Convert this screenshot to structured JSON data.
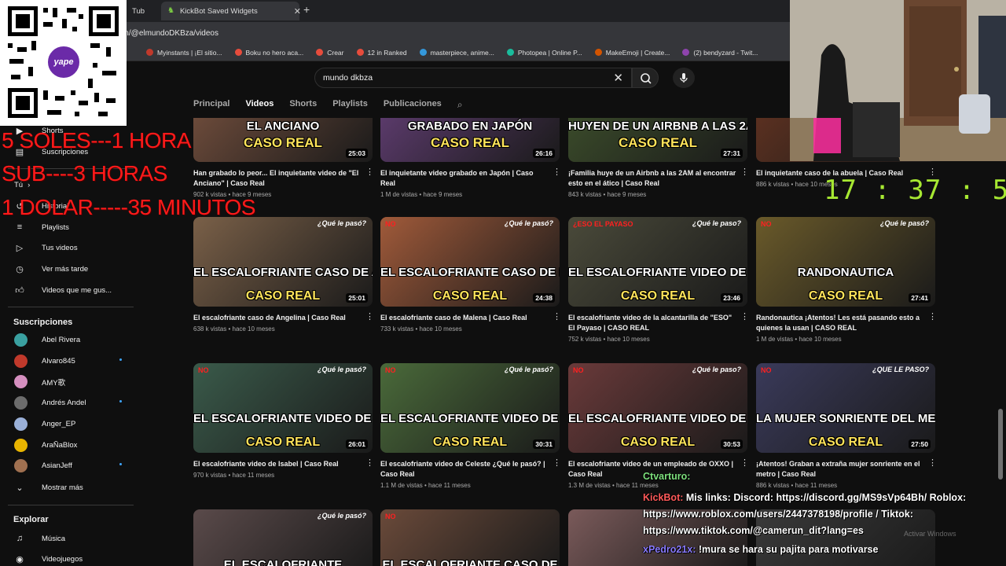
{
  "browser": {
    "tabs": [
      {
        "label": "Tub"
      },
      {
        "label": "KickBot Saved Widgets",
        "active": true
      }
    ],
    "new_tab_label": "+",
    "url": "om/@elmundoDKBza/videos",
    "bookmarks": [
      {
        "label": "Myinstants | ¡El sitio...",
        "color": "#c0392b"
      },
      {
        "label": "Boku no hero aca...",
        "color": "#e74c3c"
      },
      {
        "label": "Crear",
        "color": "#e74c3c"
      },
      {
        "label": "12 in Ranked",
        "color": "#e74c3c"
      },
      {
        "label": "masterpiece, anime...",
        "color": "#3498db"
      },
      {
        "label": "Photopea | Online P...",
        "color": "#1abc9c"
      },
      {
        "label": "MakeEmoji | Create...",
        "color": "#d35400"
      },
      {
        "label": "(2) bendyzard - Twit...",
        "color": "#8e44ad"
      }
    ]
  },
  "search": {
    "query": "mundo dkbza",
    "clear_icon": "close-icon",
    "search_icon": "search-icon",
    "mic_icon": "mic-icon"
  },
  "channel_tabs": [
    "Principal",
    "Videos",
    "Shorts",
    "Playlists",
    "Publicaciones"
  ],
  "sidebar": {
    "top_items": [
      {
        "label": "Shorts",
        "icon": "shorts-icon"
      },
      {
        "label": "Suscripciones",
        "icon": "subscriptions-icon"
      }
    ],
    "you_label": "Tú",
    "you_items": [
      {
        "label": "Historial",
        "icon": "history-icon"
      },
      {
        "label": "Playlists",
        "icon": "playlist-icon"
      },
      {
        "label": "Tus videos",
        "icon": "your-videos-icon"
      },
      {
        "label": "Ver más tarde",
        "icon": "clock-icon"
      },
      {
        "label": "Videos que me gus...",
        "icon": "thumbs-up-icon"
      }
    ],
    "subscriptions_heading": "Suscripciones",
    "subscriptions": [
      {
        "label": "Abel Rivera",
        "color": "#3aa0a0",
        "new": false
      },
      {
        "label": "Alvaro845",
        "color": "#c0392b",
        "new": true
      },
      {
        "label": "AMY歌",
        "color": "#d58fbf",
        "new": false
      },
      {
        "label": "Andrés Andel",
        "color": "#6c6c6c",
        "new": true
      },
      {
        "label": "Anger_EP",
        "color": "#9ab0d8",
        "new": false
      },
      {
        "label": "AraÑaBlox",
        "color": "#e8b400",
        "new": false
      },
      {
        "label": "AsianJeff",
        "color": "#a07050",
        "new": true
      }
    ],
    "show_more": "Mostrar más",
    "explore_heading": "Explorar",
    "explore_items": [
      {
        "label": "Música",
        "icon": "music-icon"
      },
      {
        "label": "Videojuegos",
        "icon": "gaming-icon"
      }
    ]
  },
  "videos": [
    {
      "title": "Han grabado lo peor... El inquietante video de \"El Anciano\" | Caso Real",
      "meta": "902 k vistas • hace 9 meses",
      "duration": "25:03",
      "thumb_line1": "EL ANCIANO",
      "thumb_line2": "CASO REAL",
      "thumb_color": "#6b4a3a"
    },
    {
      "title": "El inquietante video grabado en Japón | Caso Real",
      "meta": "1 M de vistas • hace 9 meses",
      "duration": "26:16",
      "thumb_line1": "GRABADO EN JAPÓN",
      "thumb_line2": "CASO REAL",
      "thumb_color": "#5a3a6a"
    },
    {
      "title": "¡Familia huye de un Airbnb a las 2AM al encontrar esto en el ático | Caso Real",
      "meta": "843 k vistas • hace 9 meses",
      "duration": "27:31",
      "thumb_line1": "HUYEN DE UN AIRBNB A LAS 2AM",
      "thumb_line2": "CASO REAL",
      "thumb_color": "#3a4a2a"
    },
    {
      "title": "El inquietante caso de la abuela | Caso Real",
      "meta": "886 k vistas • hace 10 meses",
      "duration": "",
      "thumb_line1": "",
      "thumb_line2": "",
      "thumb_color": "#5a3020"
    },
    {
      "title": "El escalofriante caso de Angelina | Caso Real",
      "meta": "638 k vistas • hace 10 meses",
      "duration": "25:01",
      "thumb_line1": "EL ESCALOFRIANTE CASO DE ANGELINA",
      "thumb_line2": "CASO REAL",
      "thumb_color": "#7a6048",
      "badge": "¿Qué le pasó?"
    },
    {
      "title": "El escalofriante caso de Malena | Caso Real",
      "meta": "733 k vistas • hace 10 meses",
      "duration": "24:38",
      "thumb_line1": "EL ESCALOFRIANTE CASO DE MALENA",
      "thumb_line2": "CASO REAL",
      "thumb_color": "#a05a3a",
      "badge": "¿Qué le pasó?",
      "no": "NO"
    },
    {
      "title": "El escalofriante video de la alcantarilla de \"ESO\" El Payaso | CASO REAL",
      "meta": "752 k vistas • hace 10 meses",
      "duration": "23:46",
      "thumb_line1": "EL ESCALOFRIANTE VIDEO DE LA ALCANTARILLA",
      "thumb_line2": "CASO REAL",
      "thumb_color": "#4a4a3a",
      "badge": "¿Qué le paso?",
      "no": "¿ESO EL PAYASO"
    },
    {
      "title": "Randonautica ¡Atentos! Les está pasando esto a quienes la usan | CASO REAL",
      "meta": "1 M de vistas • hace 10 meses",
      "duration": "27:41",
      "thumb_line1": "RANDONAUTICA",
      "thumb_line2": "CASO REAL",
      "thumb_color": "#6a5a2a",
      "badge": "¿Qué le pasó?",
      "no": "NO"
    },
    {
      "title": "El escalofriante video de Isabel | Caso Real",
      "meta": "970 k vistas • hace 11 meses",
      "duration": "26:01",
      "thumb_line1": "EL ESCALOFRIANTE VIDEO DE ISABEL",
      "thumb_line2": "CASO REAL",
      "thumb_color": "#3a5a4a",
      "badge": "¿Qué le pasó?",
      "no": "NO"
    },
    {
      "title": "El escalofriante video de Celeste ¿Qué le pasó? | Caso Real",
      "meta": "1.1 M de vistas • hace 11 meses",
      "duration": "30:31",
      "thumb_line1": "EL ESCALOFRIANTE VIDEO DE CELESTE",
      "thumb_line2": "CASO REAL",
      "thumb_color": "#4a6a3a",
      "badge": "¿Qué le pasó?",
      "no": "NO"
    },
    {
      "title": "El escalofriante video de un empleado de OXXO | Caso Real",
      "meta": "1.3 M de vistas • hace 11 meses",
      "duration": "30:53",
      "thumb_line1": "EL ESCALOFRIANTE VIDEO DE UN EMPLEADO DE OXXO",
      "thumb_line2": "CASO REAL",
      "thumb_color": "#6a3a3a",
      "badge": "¿Qué le paso?",
      "no": "NO"
    },
    {
      "title": "¡Atentos! Graban a extraña mujer sonriente en el metro | Caso Real",
      "meta": "886 k vistas • hace 11 meses",
      "duration": "27:50",
      "thumb_line1": "LA MUJER SONRIENTE DEL METRO DE LA CDMX",
      "thumb_line2": "CASO REAL",
      "thumb_color": "#3a3a5a",
      "badge": "¿QUE LE PASO?",
      "no": "NO"
    },
    {
      "title": "",
      "meta": "",
      "duration": "",
      "thumb_line1": "EL ESCALOFRIANTE",
      "thumb_line2": "",
      "thumb_color": "#5a4a4a",
      "badge": "¿Qué le pasó?"
    },
    {
      "title": "",
      "meta": "",
      "duration": "",
      "thumb_line1": "EL ESCALOFRIANTE CASO DE",
      "thumb_line2": "",
      "thumb_color": "#6a4a3a",
      "no": "NO"
    },
    {
      "title": "",
      "meta": "",
      "duration": "",
      "thumb_line1": "",
      "thumb_line2": "",
      "thumb_color": "#7a5a5a"
    },
    {
      "title": "",
      "meta": "",
      "duration": "",
      "thumb_line1": "",
      "thumb_line2": "",
      "thumb_color": "#3a3a3a"
    }
  ],
  "overlay": {
    "qr_logo": "yape",
    "promo_lines": [
      "5 SOLES---1 HORA",
      "SUB----3 HORAS",
      "1 DOLAR-----35 MINUTOS"
    ],
    "timer": "17 : 37 : 57",
    "chat": [
      {
        "name": "Ctvarturo:",
        "message": ""
      },
      {
        "name": "KickBot:",
        "message": "Mis links: Discord: https://discord.gg/MS9sVp64Bh/ Roblox: https://www.roblox.com/users/2447378198/profile / Tiktok: https://www.tiktok.com/@camerun_dit?lang=es"
      },
      {
        "name": "xPedro21x:",
        "message": "!mura se hara su pajita para motivarse"
      }
    ],
    "windows_watermark": "Activar Windows"
  }
}
